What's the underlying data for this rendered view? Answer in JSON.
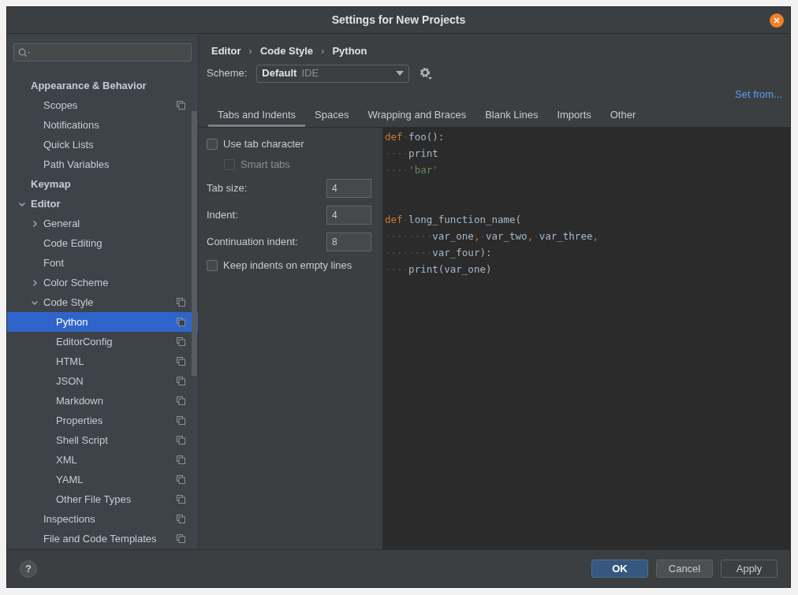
{
  "window": {
    "title": "Settings for New Projects"
  },
  "sidebar": {
    "items": [
      {
        "label": "Appearance & Behavior",
        "bold": true,
        "selected": false,
        "scheme_icon": false,
        "children": [
          {
            "label": "Scopes",
            "selected": false,
            "scheme_icon": true
          },
          {
            "label": "Notifications",
            "selected": false,
            "scheme_icon": false
          },
          {
            "label": "Quick Lists",
            "selected": false,
            "scheme_icon": false
          },
          {
            "label": "Path Variables",
            "selected": false,
            "scheme_icon": false
          }
        ]
      },
      {
        "label": "Keymap",
        "bold": true,
        "selected": false,
        "scheme_icon": false
      },
      {
        "label": "Editor",
        "bold": true,
        "expanded": true,
        "selected": false,
        "scheme_icon": false,
        "children": [
          {
            "label": "General",
            "expanded": false,
            "selected": false,
            "scheme_icon": false
          },
          {
            "label": "Code Editing",
            "selected": false,
            "scheme_icon": false
          },
          {
            "label": "Font",
            "selected": false,
            "scheme_icon": false
          },
          {
            "label": "Color Scheme",
            "expanded": false,
            "selected": false,
            "scheme_icon": false
          },
          {
            "label": "Code Style",
            "expanded": true,
            "selected": false,
            "scheme_icon": true,
            "children": [
              {
                "label": "Python",
                "selected": true,
                "scheme_icon": true
              },
              {
                "label": "EditorConfig",
                "selected": false,
                "scheme_icon": true
              },
              {
                "label": "HTML",
                "selected": false,
                "scheme_icon": true
              },
              {
                "label": "JSON",
                "selected": false,
                "scheme_icon": true
              },
              {
                "label": "Markdown",
                "selected": false,
                "scheme_icon": true
              },
              {
                "label": "Properties",
                "selected": false,
                "scheme_icon": true
              },
              {
                "label": "Shell Script",
                "selected": false,
                "scheme_icon": true
              },
              {
                "label": "XML",
                "selected": false,
                "scheme_icon": true
              },
              {
                "label": "YAML",
                "selected": false,
                "scheme_icon": true
              },
              {
                "label": "Other File Types",
                "selected": false,
                "scheme_icon": true
              }
            ]
          },
          {
            "label": "Inspections",
            "selected": false,
            "scheme_icon": true
          },
          {
            "label": "File and Code Templates",
            "selected": false,
            "scheme_icon": true
          }
        ]
      }
    ]
  },
  "breadcrumb": {
    "items": [
      "Editor",
      "Code Style",
      "Python"
    ],
    "separator": "›"
  },
  "scheme": {
    "label": "Scheme:",
    "value": "Default",
    "tag": "IDE"
  },
  "set_from": "Set from...",
  "tabs": [
    {
      "label": "Tabs and Indents",
      "selected": true
    },
    {
      "label": "Spaces",
      "selected": false
    },
    {
      "label": "Wrapping and Braces",
      "selected": false
    },
    {
      "label": "Blank Lines",
      "selected": false
    },
    {
      "label": "Imports",
      "selected": false
    },
    {
      "label": "Other",
      "selected": false
    }
  ],
  "options": [
    {
      "kind": "checkbox",
      "label": "Use tab character",
      "checked": false,
      "disabled": false
    },
    {
      "kind": "checkbox",
      "label": "Smart tabs",
      "checked": false,
      "disabled": true
    },
    {
      "kind": "number",
      "label": "Tab size:",
      "value": "4"
    },
    {
      "kind": "number",
      "label": "Indent:",
      "value": "4"
    },
    {
      "kind": "number",
      "label": "Continuation indent:",
      "value": "8"
    },
    {
      "kind": "checkbox",
      "label": "Keep indents on empty lines",
      "checked": false,
      "disabled": false
    }
  ],
  "code": [
    [
      {
        "kind": "keyword",
        "text": "def"
      },
      {
        "kind": "space",
        "text": "·"
      },
      {
        "kind": "plain",
        "text": "foo():"
      }
    ],
    [
      {
        "kind": "space",
        "text": "····"
      },
      {
        "kind": "plain",
        "text": "print"
      }
    ],
    [
      {
        "kind": "space",
        "text": "····"
      },
      {
        "kind": "string",
        "text": "'bar'"
      }
    ],
    [
      {
        "kind": "blank"
      }
    ],
    [
      {
        "kind": "blank"
      }
    ],
    [
      {
        "kind": "keyword",
        "text": "def"
      },
      {
        "kind": "space",
        "text": "·"
      },
      {
        "kind": "plain",
        "text": "long_function_name("
      }
    ],
    [
      {
        "kind": "space",
        "text": "········"
      },
      {
        "kind": "plain",
        "text": "var_one"
      },
      {
        "kind": "punct",
        "text": ","
      },
      {
        "kind": "space",
        "text": "·"
      },
      {
        "kind": "plain",
        "text": "var_two"
      },
      {
        "kind": "punct",
        "text": ","
      },
      {
        "kind": "space",
        "text": "·"
      },
      {
        "kind": "plain",
        "text": "var_three"
      },
      {
        "kind": "punct",
        "text": ","
      }
    ],
    [
      {
        "kind": "space",
        "text": "········"
      },
      {
        "kind": "plain",
        "text": "var_four):"
      }
    ],
    [
      {
        "kind": "space",
        "text": "····"
      },
      {
        "kind": "plain",
        "text": "print(var_one)"
      }
    ]
  ],
  "buttons": [
    {
      "label": "OK",
      "kind": "primary",
      "disabled": false
    },
    {
      "label": "Cancel",
      "kind": "normal",
      "disabled": false
    },
    {
      "label": "Apply",
      "kind": "normal",
      "disabled": true
    }
  ],
  "help": "?"
}
